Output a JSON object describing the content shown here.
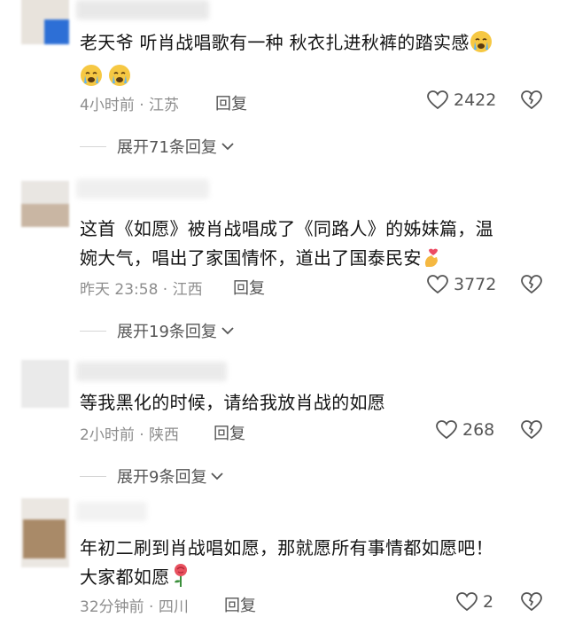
{
  "comments": [
    {
      "text": "老天爷 听肖战唱歌有一种 秋衣扎进秋裤的踏实感",
      "emoji_tail": [
        "crying-emoji",
        "crying-emoji",
        "crying-emoji"
      ],
      "time": "4小时前 · 江苏",
      "reply": "回复",
      "likes": "2422",
      "expand": "展开71条回复"
    },
    {
      "text_line1": "这首《如愿》被肖战唱成了《同路人》的姊妹篇，温",
      "text_line2": "婉大气，唱出了家国情怀，道出了国泰民安",
      "emoji_tail": [
        "finger-heart-emoji"
      ],
      "time": "昨天 23:58 · 江西",
      "reply": "回复",
      "likes": "3772",
      "expand": "展开19条回复"
    },
    {
      "text": "等我黑化的时候，请给我放肖战的如愿",
      "time": "2小时前 · 陕西",
      "reply": "回复",
      "likes": "268",
      "expand": "展开9条回复"
    },
    {
      "text_line1": "年初二刷到肖战唱如愿，那就愿所有事情都如愿吧！",
      "text_line2": "大家都如愿",
      "emoji_tail": [
        "rose-emoji"
      ],
      "time": "32分钟前 · 四川",
      "reply": "回复",
      "likes": "2"
    }
  ],
  "colors": {
    "meta": "#8d8d8d",
    "text": "#141414",
    "icon": "#555555"
  }
}
